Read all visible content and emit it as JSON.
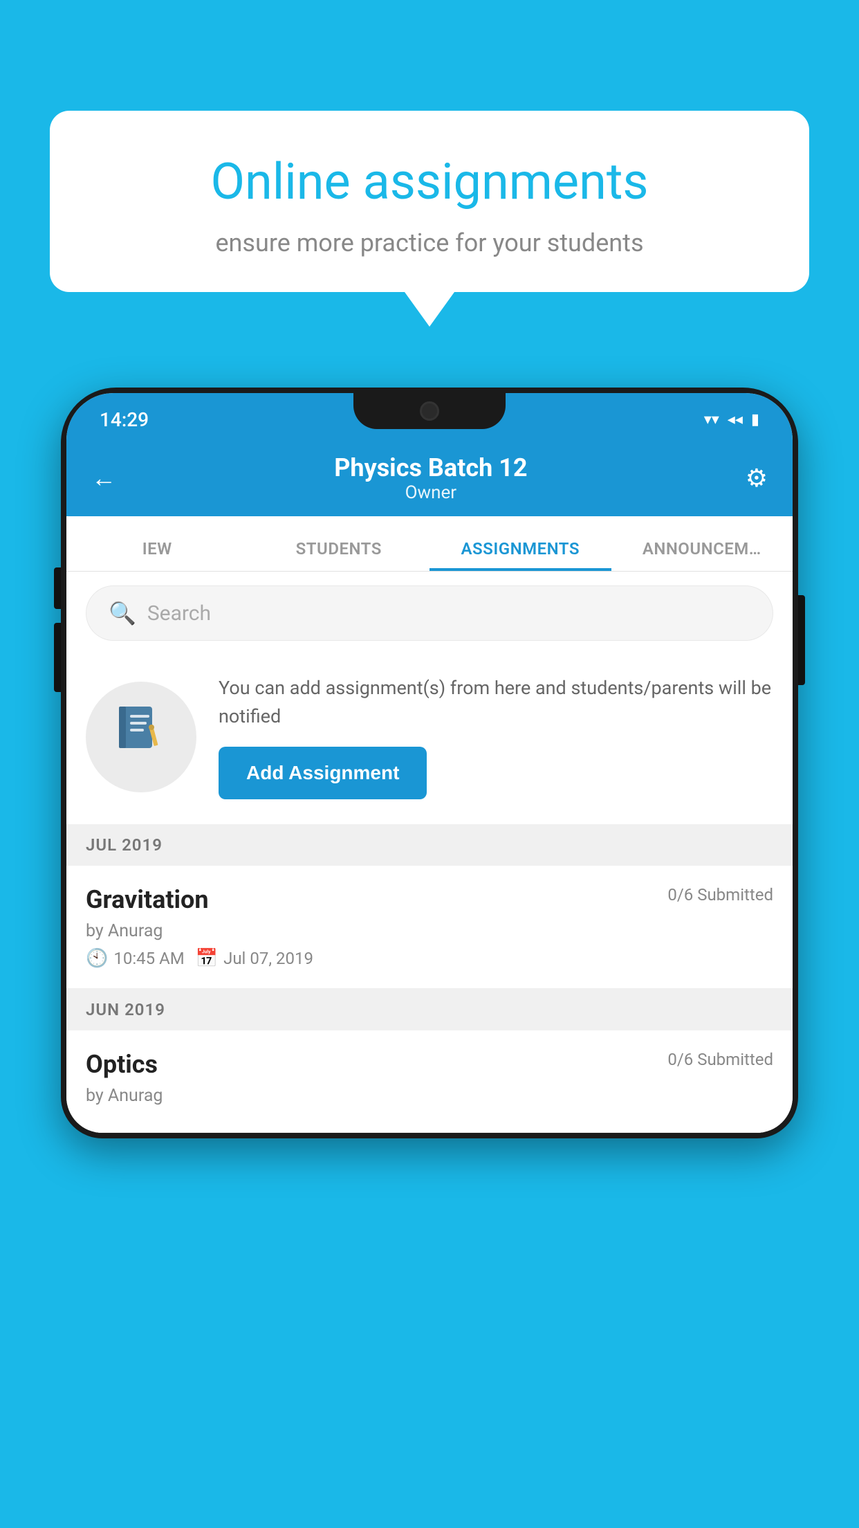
{
  "background_color": "#1ab8e8",
  "speech_bubble": {
    "title": "Online assignments",
    "subtitle": "ensure more practice for your students"
  },
  "status_bar": {
    "time": "14:29",
    "wifi_icon": "▼",
    "signal_icon": "◀",
    "battery_icon": "▮"
  },
  "header": {
    "back_label": "←",
    "title": "Physics Batch 12",
    "subtitle": "Owner",
    "settings_icon": "⚙"
  },
  "tabs": [
    {
      "label": "IEW",
      "active": false
    },
    {
      "label": "STUDENTS",
      "active": false
    },
    {
      "label": "ASSIGNMENTS",
      "active": true
    },
    {
      "label": "ANNOUNCEMENTS",
      "active": false
    }
  ],
  "search": {
    "placeholder": "Search"
  },
  "add_assignment_section": {
    "icon": "📓",
    "description": "You can add assignment(s) from here and students/parents will be notified",
    "button_label": "Add Assignment"
  },
  "assignment_sections": [
    {
      "month_label": "JUL 2019",
      "items": [
        {
          "title": "Gravitation",
          "submitted": "0/6 Submitted",
          "author": "by Anurag",
          "time": "10:45 AM",
          "date": "Jul 07, 2019"
        }
      ]
    },
    {
      "month_label": "JUN 2019",
      "items": [
        {
          "title": "Optics",
          "submitted": "0/6 Submitted",
          "author": "by Anurag",
          "time": "",
          "date": ""
        }
      ]
    }
  ]
}
